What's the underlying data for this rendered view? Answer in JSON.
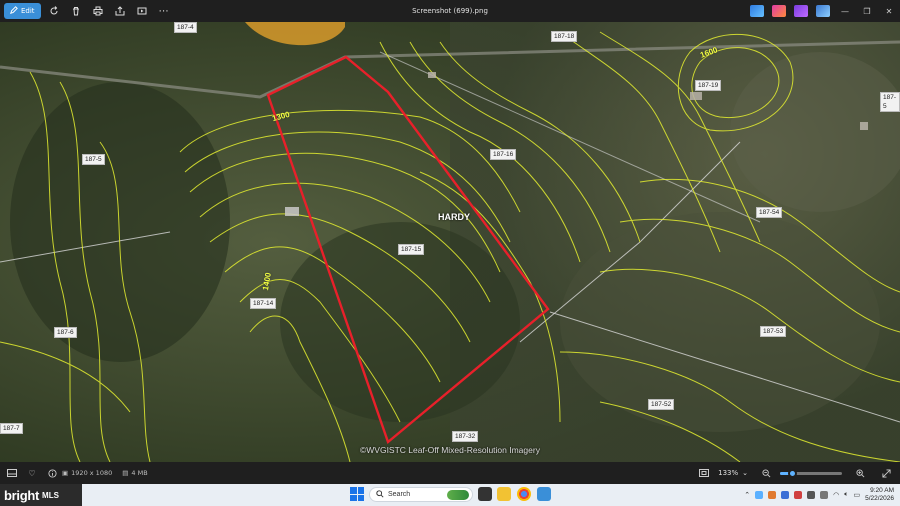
{
  "toolbar": {
    "edit_label": "Edit",
    "file_title": "Screenshot (699).png",
    "icons": [
      "rotate-icon",
      "delete-icon",
      "print-icon",
      "share-icon",
      "slideshow-icon",
      "more-icon"
    ]
  },
  "map": {
    "owner_label": "HARDY",
    "credit": "©WVGISTC Leaf-Off Mixed-Resolution Imagery",
    "parcel_labels": [
      "187-18",
      "187-19",
      "187-5",
      "187-16",
      "187-15",
      "187-14",
      "187-6",
      "187-54",
      "187-53",
      "187-52",
      "187-32",
      "187-7",
      "187-4",
      "187-5"
    ],
    "contour_labels": [
      "1600",
      "1300",
      "1400"
    ],
    "boundary_color": "#e8202a",
    "contour_color": "#e4ee30"
  },
  "statusbar": {
    "dimensions": "1920 x 1080",
    "size": "4 MB",
    "zoom": "133%",
    "zoom_fraction": 0.2
  },
  "taskbar": {
    "brand": "bright",
    "brand_suffix": "MLS",
    "search_placeholder": "Search",
    "time": "9:20 AM",
    "date": "5/22/2026"
  }
}
